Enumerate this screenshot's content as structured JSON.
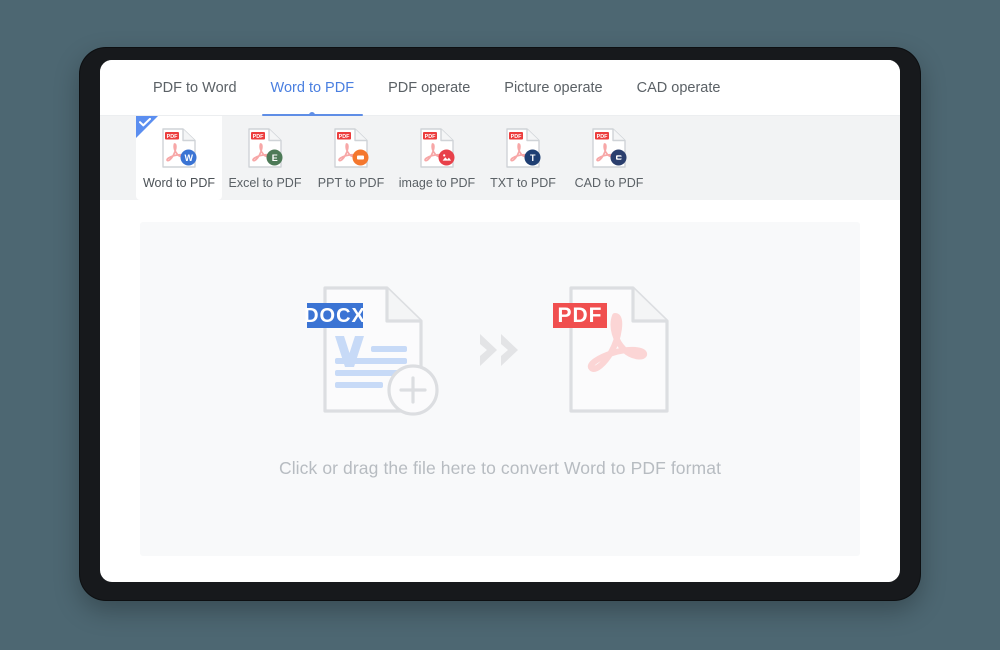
{
  "window": {
    "tabs": [
      {
        "label": "PDF to Word",
        "active": false
      },
      {
        "label": "Word to PDF",
        "active": true
      },
      {
        "label": "PDF operate",
        "active": false
      },
      {
        "label": "Picture operate",
        "active": false
      },
      {
        "label": "CAD operate",
        "active": false
      }
    ],
    "tools": [
      {
        "label": "Word to PDF",
        "badge": "W",
        "badge_color": "#3b74d4",
        "selected": true,
        "icon": "word-to-pdf-icon"
      },
      {
        "label": "Excel to PDF",
        "badge": "E",
        "badge_color": "#4d7a57",
        "selected": false,
        "icon": "excel-to-pdf-icon"
      },
      {
        "label": "PPT to PDF",
        "badge": "P",
        "badge_color": "#f4772e",
        "selected": false,
        "icon": "ppt-to-pdf-icon"
      },
      {
        "label": "image to PDF",
        "badge": "IMG",
        "badge_color": "#e8404a",
        "selected": false,
        "icon": "image-to-pdf-icon"
      },
      {
        "label": "TXT to PDF",
        "badge": "T",
        "badge_color": "#1f3f73",
        "selected": false,
        "icon": "txt-to-pdf-icon"
      },
      {
        "label": "CAD to PDF",
        "badge": "CAD",
        "badge_color": "#2b3f6e",
        "selected": false,
        "icon": "cad-to-pdf-icon"
      }
    ],
    "dropzone": {
      "hint": "Click or drag the file here to convert Word to PDF format",
      "source_badge": "DOCX",
      "target_badge": "PDF",
      "arrow": "double-chevron-right"
    },
    "colors": {
      "accent": "#4a7fe0",
      "docx_badge": "#3b74d4",
      "pdf_badge": "#f04f4f",
      "page_background": "#4d6772",
      "card_background": "#ffffff",
      "iconbar_background": "#f2f3f4",
      "dropzone_background": "#f8f9fa"
    }
  }
}
